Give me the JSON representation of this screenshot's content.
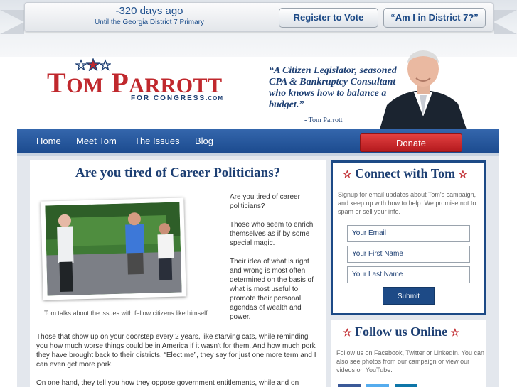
{
  "countdown": {
    "days": "-320 days ago",
    "caption": "Until the Georgia District 7 Primary"
  },
  "ribbon": {
    "register_label": "Register to Vote",
    "district_label": "“Am I in District 7?”"
  },
  "logo": {
    "first": "T",
    "first_rest": "OM",
    "last": "P",
    "last_rest": "ARROTT",
    "sub": "FOR CONGRESS",
    "domain": ".COM"
  },
  "quote": {
    "text": "“A Citizen Legislator, seasoned CPA & Bankruptcy Consultant who knows how to balance a budget.”",
    "attribution": "- Tom Parrott"
  },
  "nav": {
    "items": [
      "Home",
      "Meet Tom",
      "The Issues",
      "Blog"
    ],
    "donate": "Donate"
  },
  "article": {
    "title": "Are you tired of Career Politicians?",
    "caption": "Tom talks about the issues with fellow citizens like himself.",
    "side_paragraphs": [
      "Are you tired of career politicians?",
      "Those who seem to enrich themselves as if by some special magic.",
      "Their idea of what is right and wrong is most often determined on the basis of what is most useful to promote their personal agendas of wealth and power."
    ],
    "body_paragraphs": [
      "Those that show up on your doorstep every 2 years, like starving cats, while reminding you how much worse things could be in America if it wasn't for them. And how much pork they have brought back to their districts. “Elect me”, they say for just one more term and I can even get more pork.",
      "On one hand, they tell you how they oppose government entitlements, while and on"
    ]
  },
  "connect": {
    "title": "Connect with Tom",
    "description": "Signup for email updates about Tom's campaign, and keep up with how to help. We promise not to spam or sell your info.",
    "email_placeholder": "Your Email",
    "first_name_placeholder": "Your First Name",
    "last_name_placeholder": "Your Last Name",
    "submit": "Submit"
  },
  "follow": {
    "title": "Follow us Online",
    "description": "Follow us on Facebook, Twitter or LinkedIn. You can also see photos from our campaign or view our videos on YouTube."
  },
  "colors": {
    "brand_blue": "#1d4a86",
    "brand_red": "#c0282d"
  }
}
